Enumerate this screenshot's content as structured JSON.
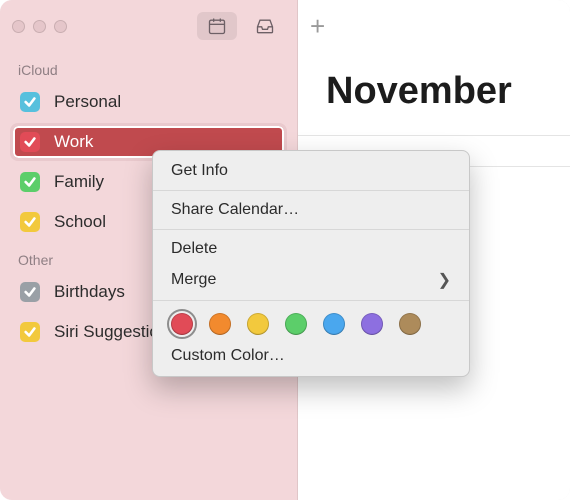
{
  "sections": {
    "icloud_label": "iCloud",
    "other_label": "Other"
  },
  "calendars_icloud": [
    {
      "label": "Personal",
      "color": "#57c0dd"
    },
    {
      "label": "Work",
      "color": "#e14b57"
    },
    {
      "label": "Family",
      "color": "#5cce6a"
    },
    {
      "label": "School",
      "color": "#f2c93d"
    }
  ],
  "calendars_other": [
    {
      "label": "Birthdays",
      "color": "#9aa0a6"
    },
    {
      "label": "Siri Suggestions",
      "color": "#f2c93d"
    }
  ],
  "main": {
    "month_title": "November"
  },
  "context_menu": {
    "get_info": "Get Info",
    "share": "Share Calendar…",
    "delete": "Delete",
    "merge": "Merge",
    "custom_color": "Custom Color…",
    "swatches": [
      "#e14b57",
      "#f28a2e",
      "#f2c93d",
      "#5cce6a",
      "#4aa7ee",
      "#8d6fe0",
      "#ad8b5b"
    ]
  }
}
